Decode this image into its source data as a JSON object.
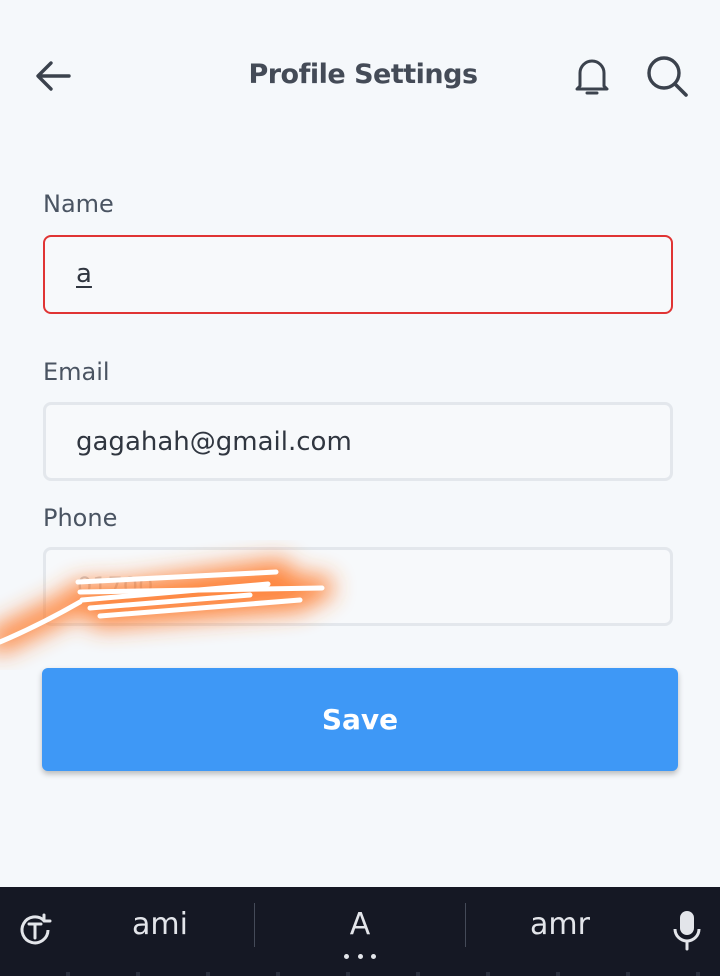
{
  "header": {
    "title": "Profile Settings",
    "back_icon": "arrow-left-icon",
    "notification_icon": "bell-icon",
    "search_icon": "search-icon"
  },
  "form": {
    "name": {
      "label": "Name",
      "value": "a"
    },
    "email": {
      "label": "Email",
      "value": "gagahah@gmail.com"
    },
    "phone": {
      "label": "Phone",
      "placeholder": "01700"
    },
    "save_label": "Save"
  },
  "keyboard": {
    "suggestions": [
      "ami",
      "A",
      "amr"
    ],
    "tool_icon": "translate-icon",
    "mic_icon": "microphone-icon"
  },
  "colors": {
    "background": "#f5f8fb",
    "accent": "#3e98f6",
    "error": "#e03434",
    "keyboard_bg": "#151824",
    "annotation": "#ff7a2a"
  }
}
